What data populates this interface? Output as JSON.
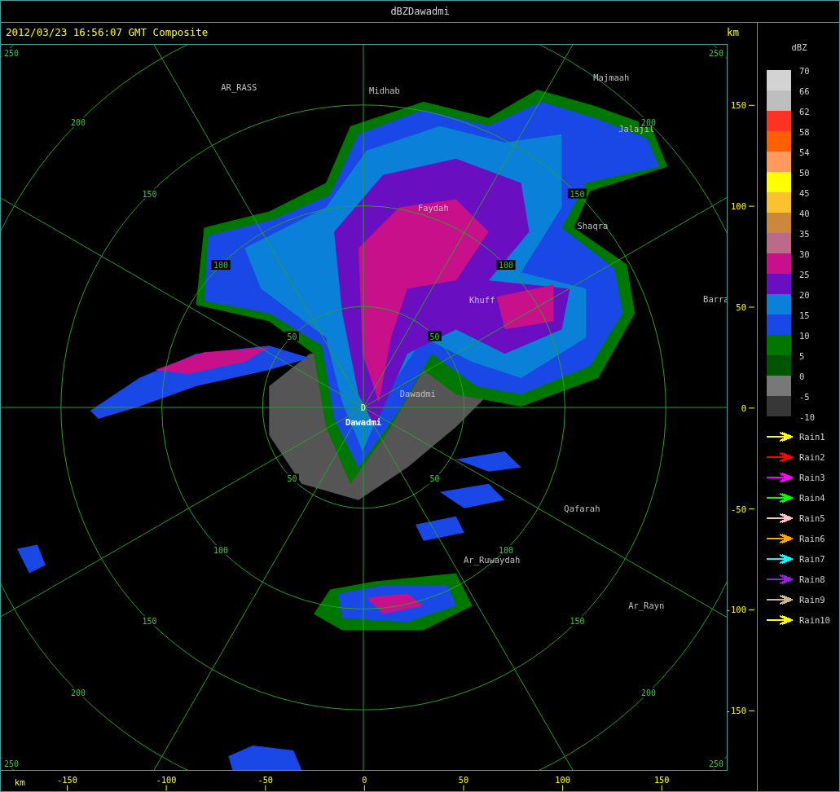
{
  "window": {
    "title": "dBZDawadmi"
  },
  "header": {
    "timestamp": "2012/03/23 16:56:07 GMT Composite",
    "unit": "km"
  },
  "plot": {
    "range_rings": [
      {
        "labels": [
          "50",
          "50",
          "50",
          "50"
        ]
      },
      {
        "labels": [
          "100",
          "100",
          "100",
          "100"
        ]
      },
      {
        "labels": [
          "150",
          "150",
          "150",
          "150"
        ]
      },
      {
        "labels": [
          "200",
          "200",
          "200",
          "200"
        ]
      },
      {
        "labels": [
          "250",
          "250",
          "250",
          "250"
        ]
      }
    ],
    "places": [
      "AR_RASS",
      "Midhab",
      "Majmaah",
      "Jalajil",
      "Faydah",
      "Shaqra",
      "Barra",
      "Khuff",
      "Dawadmi",
      "Qafarah",
      "Ar_Ruwaydah",
      "Ar_Rayn"
    ],
    "site": {
      "marker": "D",
      "name": "Dawadmi"
    }
  },
  "y_axis": {
    "ticks": [
      "150",
      "100",
      "50",
      "0",
      "-50",
      "-100",
      "-150"
    ]
  },
  "x_axis": {
    "unit": "km",
    "ticks": [
      "-150",
      "-100",
      "-50",
      "0",
      "50",
      "100",
      "150"
    ]
  },
  "legend": {
    "title": "dBZ",
    "labels": [
      "70",
      "66",
      "62",
      "58",
      "54",
      "50",
      "45",
      "40",
      "35",
      "30",
      "25",
      "20",
      "15",
      "10",
      "5",
      "0",
      "-5",
      "-10"
    ],
    "bins": [
      {
        "color": "#d3d3d3"
      },
      {
        "color": "#bebebe"
      },
      {
        "color": "#ff3322"
      },
      {
        "color": "#ff5f00"
      },
      {
        "color": "#ff9a5c"
      },
      {
        "color": "#ffff00"
      },
      {
        "color": "#fac22f"
      },
      {
        "color": "#cd873c"
      },
      {
        "color": "#bc6a8a"
      },
      {
        "color": "#c8108a"
      },
      {
        "color": "#6a0ec2"
      },
      {
        "color": "#0a80d8"
      },
      {
        "color": "#1a48e6"
      },
      {
        "color": "#007800"
      },
      {
        "color": "#005500"
      },
      {
        "color": "#787878"
      },
      {
        "color": "#373737"
      }
    ],
    "tracks": [
      {
        "label": "Rain1",
        "color": "#ffff00"
      },
      {
        "label": "Rain2",
        "color": "#ff0000"
      },
      {
        "label": "Rain3",
        "color": "#ff00ff"
      },
      {
        "label": "Rain4",
        "color": "#00ff00"
      },
      {
        "label": "Rain5",
        "color": "#ffc0cb"
      },
      {
        "label": "Rain6",
        "color": "#ffa500"
      },
      {
        "label": "Rain7",
        "color": "#00ffff"
      },
      {
        "label": "Rain8",
        "color": "#9a20e0"
      },
      {
        "label": "Rain9",
        "color": "#d2b48c"
      },
      {
        "label": "Rain10",
        "color": "#ffff00"
      }
    ]
  }
}
